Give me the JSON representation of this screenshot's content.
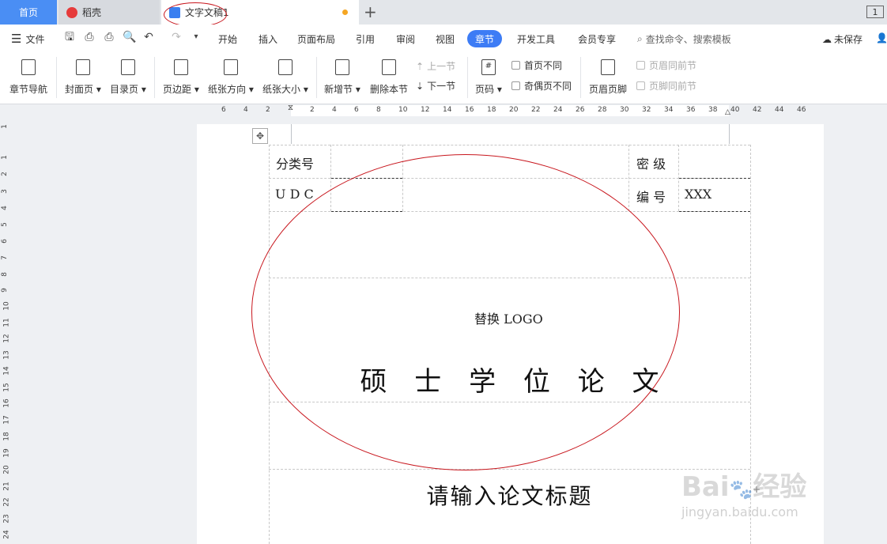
{
  "tabs": {
    "home": "首页",
    "daoke": "稻壳",
    "document": "文字文稿1",
    "window_count": "1"
  },
  "menu": {
    "file": "文件",
    "items": [
      "开始",
      "插入",
      "页面布局",
      "引用",
      "审阅",
      "视图",
      "章节",
      "开发工具",
      "会员专享"
    ],
    "active": "章节",
    "search_placeholder": "查找命令、搜索模板",
    "save_status": "未保存"
  },
  "ribbon": {
    "nav": "章节导航",
    "cover": "封面页",
    "toc": "目录页",
    "margin": "页边距",
    "orientation": "纸张方向",
    "size": "纸张大小",
    "new_section": "新增节",
    "delete_section": "删除本节",
    "prev_section": "上一节",
    "next_section": "下一节",
    "page_number": "页码",
    "first_page_diff": "首页不同",
    "odd_even_diff": "奇偶页不同",
    "header_footer": "页眉页脚",
    "header_same": "页眉同前节",
    "footer_same": "页脚同前节"
  },
  "ruler": {
    "horizontal": [
      "6",
      "4",
      "2",
      "2",
      "4",
      "6",
      "8",
      "10",
      "12",
      "14",
      "16",
      "18",
      "20",
      "22",
      "24",
      "26",
      "28",
      "30",
      "32",
      "34",
      "36",
      "38",
      "40",
      "42",
      "44",
      "46"
    ],
    "vertical": [
      "1",
      "1",
      "2",
      "3",
      "4",
      "5",
      "6",
      "7",
      "8",
      "9",
      "10",
      "11",
      "12",
      "13",
      "14",
      "15",
      "16",
      "17",
      "18",
      "19",
      "20",
      "21",
      "22",
      "23",
      "24"
    ]
  },
  "document": {
    "class_label": "分类号",
    "secret_label": "密 级",
    "udc_label": "U D C",
    "number_label": "编 号",
    "number_value": "XXX",
    "logo_text": "替换 LOGO",
    "thesis_type": "硕 士 学 位 论 文",
    "title_placeholder": "请输入论文标题"
  },
  "watermark": {
    "brand": "Bai",
    "brand2": "经验",
    "url": "jingyan.baidu.com"
  },
  "colors": {
    "accent": "#3d7cf5",
    "annotation": "#c8171e",
    "home_tab": "#4a8ef4"
  }
}
